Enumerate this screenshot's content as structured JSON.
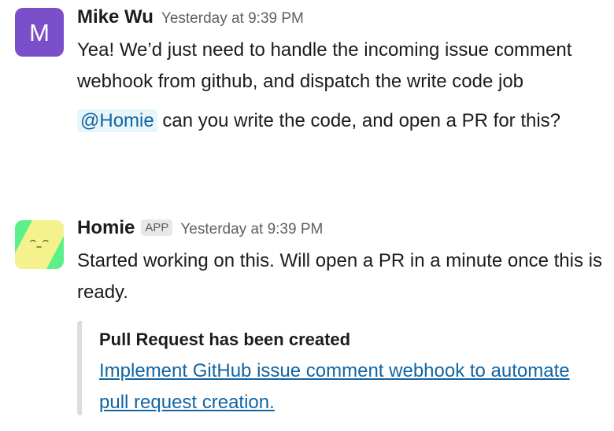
{
  "messages": [
    {
      "sender": "Mike Wu",
      "avatar_letter": "M",
      "avatar_color": "#7a4fc9",
      "timestamp": "Yesterday at 9:39 PM",
      "paragraph1": "Yea! We’d just need to handle the incoming issue comment webhook from github, and dispatch the write code job",
      "mention": "@Homie",
      "paragraph2_rest": " can you write the code, and open a PR for this?"
    },
    {
      "sender": "Homie",
      "badge": "APP",
      "avatar_icon": "homie-app-icon",
      "timestamp": "Yesterday at 9:39 PM",
      "paragraph1": "Started working on this. Will open a PR in a minute once this is ready.",
      "attachment": {
        "title": "Pull Request has been created",
        "link_text": "Implement GitHub issue comment webhook to automate pull request creation."
      }
    }
  ],
  "colors": {
    "link": "#1264a3",
    "mention_bg": "#e8f5fa",
    "attachment_bar": "#dddddd",
    "homie_green": "#5bf08a",
    "homie_yellow": "#f5f28e"
  }
}
